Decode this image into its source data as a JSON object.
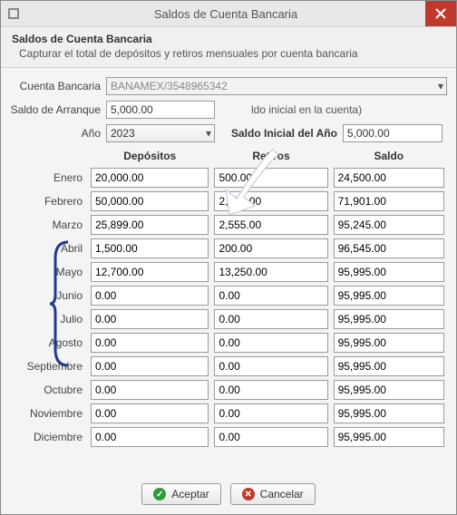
{
  "window": {
    "title": "Saldos de Cuenta Bancaria"
  },
  "header": {
    "title": "Saldos de Cuenta Bancaria",
    "subtitle": "Capturar el total de depósitos y retiros mensuales por cuenta bancaria"
  },
  "labels": {
    "cuenta": "Cuenta Bancaria",
    "saldoArranque": "Saldo de Arranque",
    "saldoArranqueHint": "ldo inicial en la cuenta)",
    "ano": "Año",
    "saldoInicialAno": "Saldo Inicial del Año",
    "col_depositos": "Depósitos",
    "col_retiros": "Retiros",
    "col_saldo": "Saldo"
  },
  "fields": {
    "cuenta": "BANAMEX/3548965342",
    "saldoArranque": "5,000.00",
    "ano": "2023",
    "saldoInicialAno": "5,000.00"
  },
  "months": [
    {
      "name": "Enero",
      "dep": "20,000.00",
      "ret": "500.00",
      "sal": "24,500.00"
    },
    {
      "name": "Febrero",
      "dep": "50,000.00",
      "ret": "2,599.00",
      "sal": "71,901.00"
    },
    {
      "name": "Marzo",
      "dep": "25,899.00",
      "ret": "2,555.00",
      "sal": "95,245.00"
    },
    {
      "name": "Abril",
      "dep": "1,500.00",
      "ret": "200.00",
      "sal": "96,545.00"
    },
    {
      "name": "Mayo",
      "dep": "12,700.00",
      "ret": "13,250.00",
      "sal": "95,995.00"
    },
    {
      "name": "Junio",
      "dep": "0.00",
      "ret": "0.00",
      "sal": "95,995.00"
    },
    {
      "name": "Julio",
      "dep": "0.00",
      "ret": "0.00",
      "sal": "95,995.00"
    },
    {
      "name": "Agosto",
      "dep": "0.00",
      "ret": "0.00",
      "sal": "95,995.00"
    },
    {
      "name": "Septiembre",
      "dep": "0.00",
      "ret": "0.00",
      "sal": "95,995.00"
    },
    {
      "name": "Octubre",
      "dep": "0.00",
      "ret": "0.00",
      "sal": "95,995.00"
    },
    {
      "name": "Noviembre",
      "dep": "0.00",
      "ret": "0.00",
      "sal": "95,995.00"
    },
    {
      "name": "Diciembre",
      "dep": "0.00",
      "ret": "0.00",
      "sal": "95,995.00"
    }
  ],
  "buttons": {
    "ok": "Aceptar",
    "cancel": "Cancelar"
  }
}
